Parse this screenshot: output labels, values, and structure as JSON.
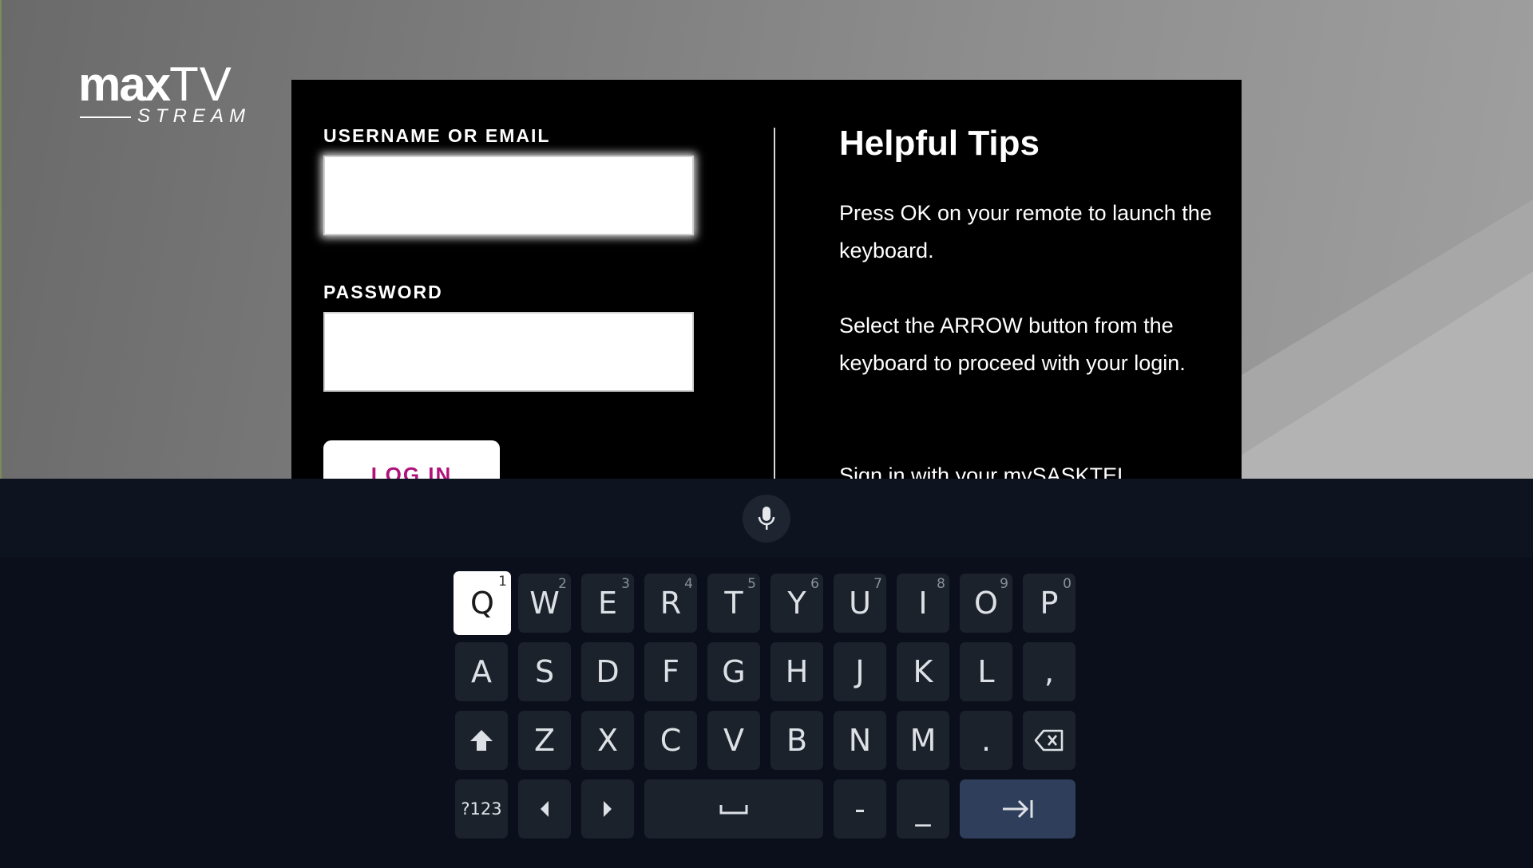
{
  "logo": {
    "main_bold": "max",
    "main_regular": "TV",
    "sub": "STREAM"
  },
  "login": {
    "username_label": "USERNAME OR EMAIL",
    "username_value": "",
    "password_label": "PASSWORD",
    "password_value": "",
    "login_button": "LOG IN"
  },
  "tips": {
    "title": "Helpful Tips",
    "items": [
      "Press OK on your remote to launch the keyboard.",
      "Select the ARROW button from the keyboard to proceed with your login.",
      "Sign in with your mySASKTEL"
    ]
  },
  "keyboard": {
    "mic_icon": "microphone-icon",
    "row1": [
      {
        "label": "Q",
        "hint": "1"
      },
      {
        "label": "W",
        "hint": "2"
      },
      {
        "label": "E",
        "hint": "3"
      },
      {
        "label": "R",
        "hint": "4"
      },
      {
        "label": "T",
        "hint": "5"
      },
      {
        "label": "Y",
        "hint": "6"
      },
      {
        "label": "U",
        "hint": "7"
      },
      {
        "label": "I",
        "hint": "8"
      },
      {
        "label": "O",
        "hint": "9"
      },
      {
        "label": "P",
        "hint": "0"
      }
    ],
    "row2": [
      "A",
      "S",
      "D",
      "F",
      "G",
      "H",
      "J",
      "K",
      "L",
      ","
    ],
    "row3": [
      "Z",
      "X",
      "C",
      "V",
      "B",
      "N",
      "M",
      "."
    ],
    "row4": {
      "symbols": "?123",
      "dash": "-",
      "underscore": "_"
    },
    "focused_key": "Q",
    "colors": {
      "focused": "#ffffff",
      "key": "#1c222c",
      "enter": "#2f3e5b",
      "login_text": "#b0127a"
    }
  }
}
